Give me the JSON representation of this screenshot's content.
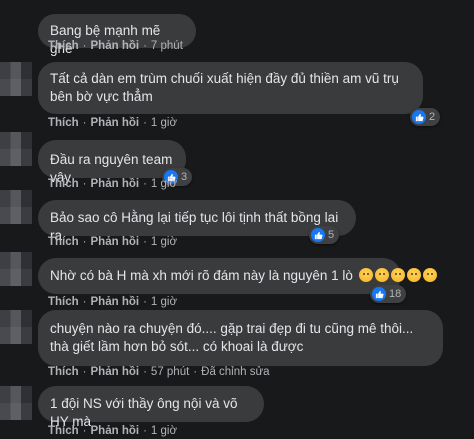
{
  "comments": [
    {
      "text": "Bang bệ mạnh mẽ ghê",
      "like": "Thích",
      "reply": "Phản hồi",
      "time": "7 phút",
      "edited": "",
      "reactions": ""
    },
    {
      "text": "Tất cả dàn em trùm chuối xuất hiện đầy đủ thiền am vũ trụ bên bờ vực thẳm",
      "like": "Thích",
      "reply": "Phản hồi",
      "time": "1 giờ",
      "edited": "",
      "reactions": "2"
    },
    {
      "text": "Đầu ra nguyên team vậy",
      "like": "Thích",
      "reply": "Phản hồi",
      "time": "1 giờ",
      "edited": "",
      "reactions": "3"
    },
    {
      "text": "Bảo sao cô Hằng lại tiếp tục lôi tịnh thất bồng lai ra.",
      "like": "Thích",
      "reply": "Phản hồi",
      "time": "1 giờ",
      "edited": "",
      "reactions": "5"
    },
    {
      "text": "Nhờ có bà H mà xh mới rõ đám này là nguyên 1 lò",
      "like": "Thích",
      "reply": "Phản hồi",
      "time": "1 giờ",
      "edited": "",
      "reactions": "18"
    },
    {
      "text": "chuyện nào ra chuyện đó.... gặp trai đẹp đi tu cũng mê thôi... thà giết lầm hơn bỏ sót... có khoai là được",
      "like": "Thích",
      "reply": "Phản hồi",
      "time": "57 phút",
      "edited": "Đã chỉnh sửa",
      "reactions": ""
    },
    {
      "text": "1 đội NS với thầy ông nội và võ HY mà",
      "like": "Thích",
      "reply": "Phản hồi",
      "time": "1 giờ",
      "edited": "",
      "reactions": ""
    }
  ],
  "colors": {
    "background": "#18191a",
    "bubble": "#3a3b3c",
    "meta": "#b0b3b8",
    "like_blue": "#1877f2"
  },
  "icons": {
    "reaction": "like-icon",
    "sad_emoji": "sad-face-emoji"
  }
}
